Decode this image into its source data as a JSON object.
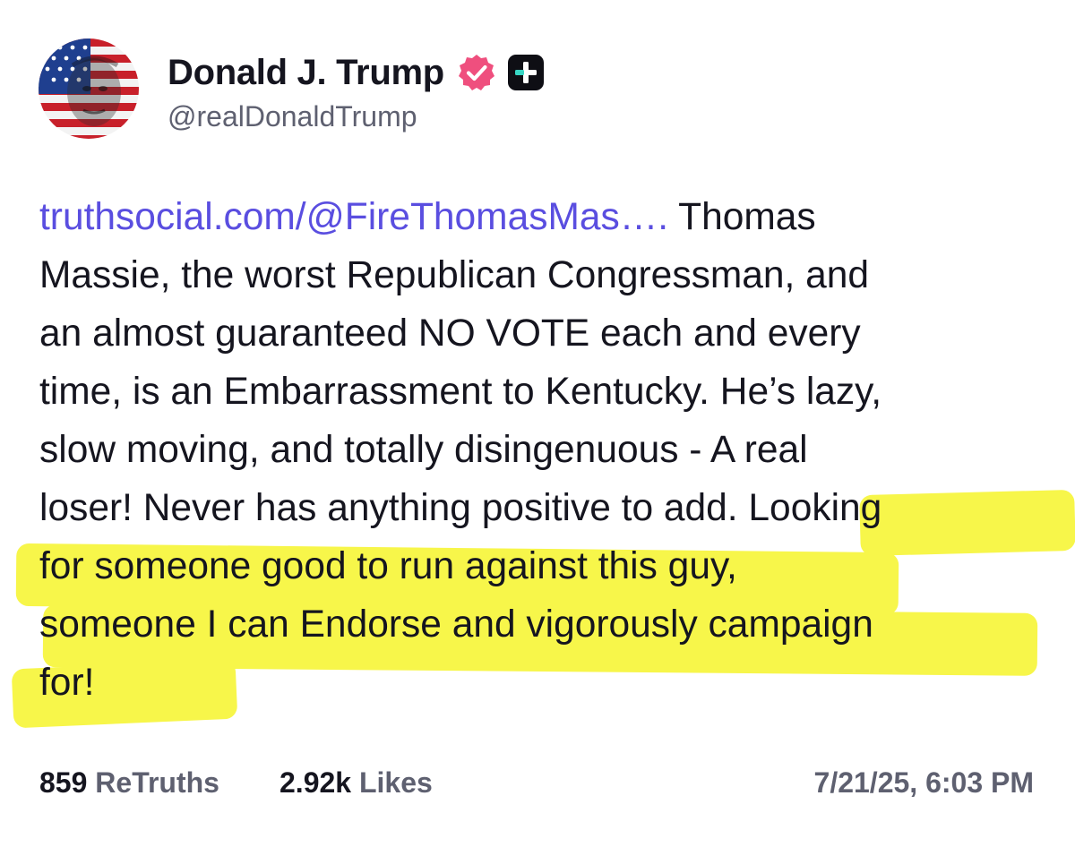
{
  "post": {
    "author": {
      "display_name": "Donald J. Trump",
      "handle": "@realDonaldTrump",
      "avatar_icon": "avatar-flag-portrait",
      "verified_icon": "verified-badge-icon",
      "subscriber_icon": "plus-badge-icon"
    },
    "body": {
      "link_text": "truthsocial.com/@FireThomasMas….",
      "lines": [
        " Thomas",
        "Massie, the worst Republican Congressman, and",
        "an almost guaranteed NO VOTE each and every",
        "time, is an Embarrassment to Kentucky. He’s lazy,",
        "slow moving, and totally disingenuous - A real",
        "loser! Never has anything positive to add. Looking",
        "for someone good to run against this guy,",
        "someone I can Endorse and vigorously campaign",
        "for!"
      ]
    },
    "stats": {
      "retruths_count": "859",
      "retruths_label": "ReTruths",
      "likes_count": "2.92k",
      "likes_label": "Likes"
    },
    "timestamp": "7/21/25, 6:03 PM"
  },
  "colors": {
    "link": "#5a4ee0",
    "text": "#15151f",
    "muted": "#5e6070",
    "highlighter": "#f7f64a",
    "verified": "#ef4f7e"
  }
}
